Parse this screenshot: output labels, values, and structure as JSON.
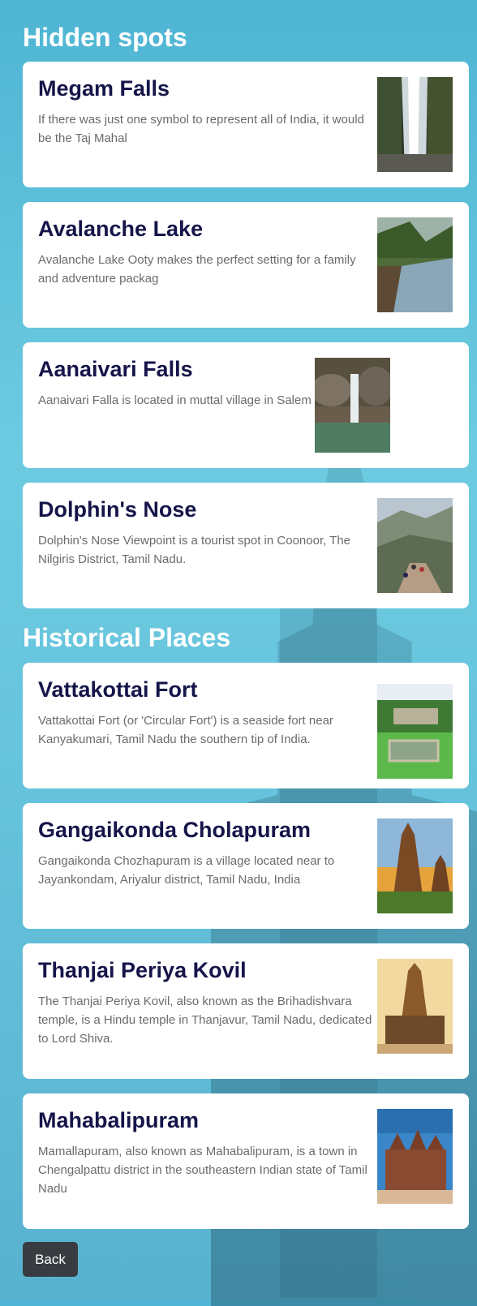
{
  "sections": [
    {
      "title": "Hidden spots",
      "items": [
        {
          "title": "Megam Falls",
          "description": "If there was just one symbol to represent all of India, it would be the Taj Mahal",
          "image": "waterfall-image"
        },
        {
          "title": "Avalanche Lake",
          "description": "Avalanche Lake Ooty makes the perfect setting for a family and adventure packag",
          "image": "lake-image"
        },
        {
          "title": "Aanaivari Falls",
          "description": "Aanaivari Falla is located in muttal village in Salem",
          "image": "waterfall-rocks-image"
        },
        {
          "title": "Dolphin's Nose",
          "description": "Dolphin's Nose Viewpoint is a tourist spot in Coonoor, The Nilgiris District, Tamil Nadu.",
          "image": "viewpoint-image"
        }
      ]
    },
    {
      "title": "Historical Places",
      "items": [
        {
          "title": "Vattakottai Fort",
          "description": "Vattakottai Fort (or 'Circular Fort') is a seaside fort near Kanyakumari, Tamil Nadu the southern tip of India.",
          "image": "fort-image"
        },
        {
          "title": "Gangaikonda Cholapuram",
          "description": "Gangaikonda Chozhapuram is a village located near to Jayankondam, Ariyalur district, Tamil Nadu, India",
          "image": "temple-sunset-image"
        },
        {
          "title": "Thanjai Periya Kovil",
          "description": "The Thanjai Periya Kovil, also known as the Brihadishvara temple, is a Hindu temple in Thanjavur, Tamil Nadu, dedicated to Lord Shiva.",
          "image": "temple-image"
        },
        {
          "title": "Mahabalipuram",
          "description": "Mamallapuram, also known as Mahabalipuram, is a town in Chengalpattu district in the southeastern Indian state of Tamil Nadu",
          "image": "shore-temple-image"
        }
      ]
    }
  ],
  "back_button": {
    "label": "Back"
  }
}
